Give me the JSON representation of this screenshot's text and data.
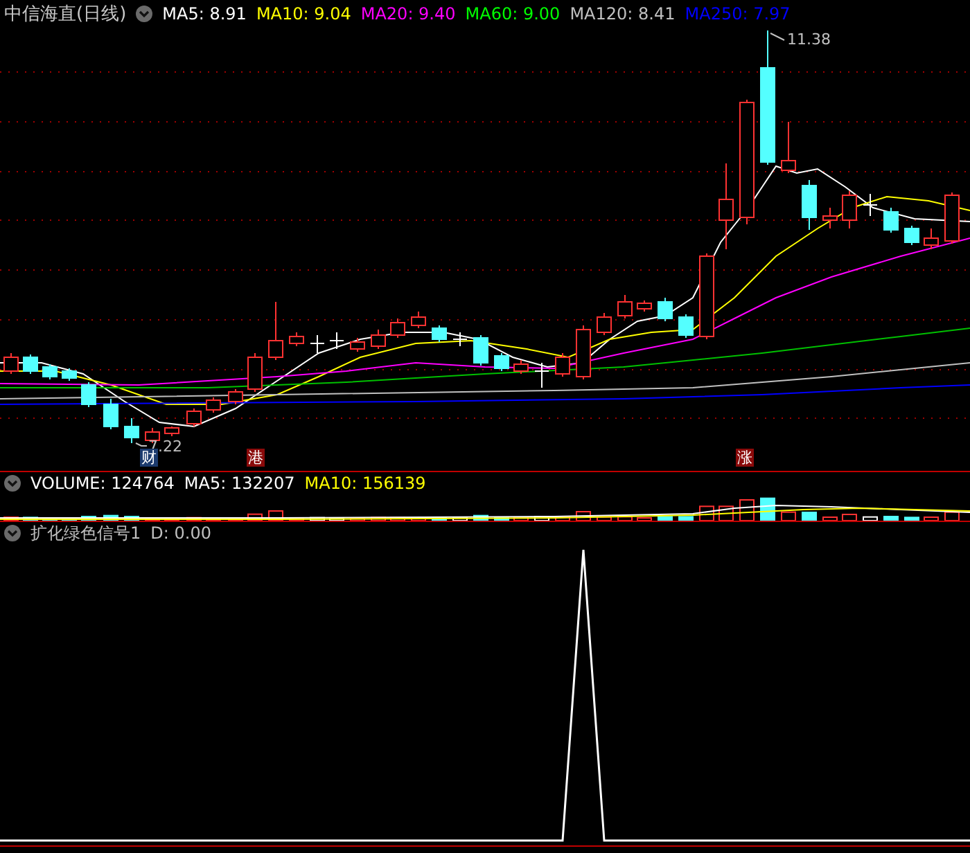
{
  "title": "中信海直(日线)",
  "ma_legend": [
    {
      "label": "MA5: 8.91",
      "color": "#ffffff"
    },
    {
      "label": "MA10: 9.04",
      "color": "#ffff00"
    },
    {
      "label": "MA20: 9.40",
      "color": "#ff00ff"
    },
    {
      "label": "MA60: 9.00",
      "color": "#00ff00"
    },
    {
      "label": "MA120: 8.41",
      "color": "#c0c0c0"
    },
    {
      "label": "MA250: 7.97",
      "color": "#0000ff"
    }
  ],
  "price_labels": {
    "high": "11.38",
    "low": "7.22"
  },
  "badges": [
    {
      "text": "财",
      "color": "#1c3b6e"
    },
    {
      "text": "港",
      "color": "#8a0a0a"
    },
    {
      "text": "涨",
      "color": "#8a0a0a"
    }
  ],
  "volume_legend": [
    {
      "label": "VOLUME: 124764",
      "color": "#ffffff"
    },
    {
      "label": "MA5: 132207",
      "color": "#ffffff"
    },
    {
      "label": "MA10: 156139",
      "color": "#ffff00"
    }
  ],
  "indicator": {
    "name": "扩化绿色信号1",
    "legend": [
      {
        "label": "D: 0.00",
        "color": "#c0c0c0"
      }
    ]
  }
}
